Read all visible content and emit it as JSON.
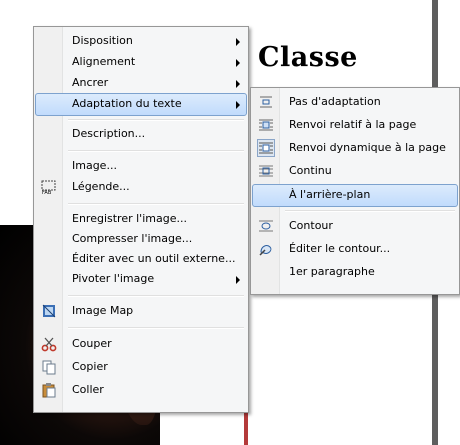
{
  "document": {
    "heading": "Classe"
  },
  "main_menu": {
    "items": [
      {
        "label": "Disposition"
      },
      {
        "label": "Alignement"
      },
      {
        "label": "Ancrer"
      },
      {
        "label": "Adaptation du texte"
      },
      {
        "label": "Description..."
      },
      {
        "label": "Image..."
      },
      {
        "label": "Légende..."
      },
      {
        "label": "Enregistrer l'image..."
      },
      {
        "label": "Compresser l'image..."
      },
      {
        "label": "Éditer avec un outil externe..."
      },
      {
        "label": "Pivoter l'image"
      },
      {
        "label": "Image Map"
      },
      {
        "label": "Couper"
      },
      {
        "label": "Copier"
      },
      {
        "label": "Coller"
      }
    ]
  },
  "sub_menu": {
    "items": [
      {
        "label": "Pas d'adaptation"
      },
      {
        "label": "Renvoi relatif à la page"
      },
      {
        "label": "Renvoi dynamique à la page"
      },
      {
        "label": "Continu"
      },
      {
        "label": "À l'arrière-plan"
      },
      {
        "label": "Contour"
      },
      {
        "label": "Éditer le contour..."
      },
      {
        "label": "1er paragraphe"
      }
    ]
  },
  "highlight_color": "#c1dbfc"
}
